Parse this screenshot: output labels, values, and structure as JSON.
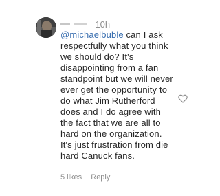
{
  "comment": {
    "time": "10h",
    "mention": "@michaelbuble",
    "lines_after_mention": " can I ask",
    "lines": [
      "respectfully what you think",
      "we should do? It's",
      "disappointing from a fan",
      "standpoint but we will never",
      "ever get the opportunity to",
      "do what Jim Rutherford",
      "does and I do agree with",
      "the fact that we are all to",
      "hard on the organization.",
      "It's just frustration from die",
      "hard Canuck fans."
    ],
    "likes": "5 likes",
    "reply": "Reply"
  },
  "icons": {
    "like": "heart-icon",
    "avatar": "avatar"
  },
  "colors": {
    "mention": "#3a6fb0",
    "text": "#262626",
    "meta": "#8e8e8e"
  }
}
